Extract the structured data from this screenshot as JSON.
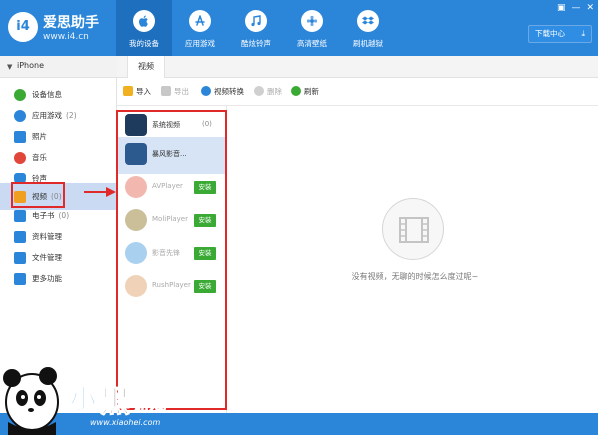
{
  "app": {
    "logo_badge": "i4",
    "name": "爱思助手",
    "url": "www.i4.cn"
  },
  "nav": {
    "tabs": [
      {
        "label": "我的设备",
        "icon": "apple-icon",
        "active": true
      },
      {
        "label": "应用游戏",
        "icon": "app-store-icon",
        "active": false
      },
      {
        "label": "酷炫铃声",
        "icon": "music-note-icon",
        "active": false
      },
      {
        "label": "高清壁纸",
        "icon": "flower-icon",
        "active": false
      },
      {
        "label": "刷机越狱",
        "icon": "dropbox-icon",
        "active": false
      }
    ],
    "download_center": "下载中心",
    "window_controls": [
      "▣",
      "—",
      "✕"
    ]
  },
  "device": {
    "name": "iPhone"
  },
  "sidebar": {
    "items": [
      {
        "label": "设备信息",
        "count": "",
        "icon": "info-icon",
        "color": "#3aaa35"
      },
      {
        "label": "应用游戏",
        "count": "(2)",
        "icon": "apps-icon",
        "color": "#2b86d9"
      },
      {
        "label": "照片",
        "count": "",
        "icon": "photo-icon",
        "color": "#2b86d9"
      },
      {
        "label": "音乐",
        "count": "",
        "icon": "music-icon",
        "color": "#e0463a"
      },
      {
        "label": "铃声",
        "count": "",
        "icon": "bell-icon",
        "color": "#2b86d9"
      },
      {
        "label": "视频",
        "count": "(0)",
        "icon": "video-icon",
        "color": "#f0a020",
        "active": true
      },
      {
        "label": "电子书",
        "count": "(0)",
        "icon": "ebook-icon",
        "color": "#2b86d9"
      },
      {
        "label": "资料管理",
        "count": "",
        "icon": "contacts-icon",
        "color": "#2b86d9"
      },
      {
        "label": "文件管理",
        "count": "",
        "icon": "file-icon",
        "color": "#2b86d9"
      },
      {
        "label": "更多功能",
        "count": "",
        "icon": "more-icon",
        "color": "#2b86d9"
      }
    ]
  },
  "tabs": {
    "current": "视频"
  },
  "toolbar": {
    "import": "导入",
    "export": "导出",
    "convert": "视频转换",
    "delete": "删除",
    "refresh": "刷新"
  },
  "apps": [
    {
      "name": "系统视频",
      "count": "(0)",
      "install": "",
      "icon": "clapperboard-icon",
      "color": "#1e3a5c"
    },
    {
      "name": "暴风影音...",
      "count": "",
      "install": "",
      "icon": "baofeng-icon",
      "color": "#2c5a8e",
      "selected": true
    },
    {
      "name": "AVPlayer",
      "count": "",
      "install": "安装",
      "icon": "avplayer-icon",
      "color": "#f2b8b0",
      "faded": true
    },
    {
      "name": "MoliPlayer",
      "count": "",
      "install": "安装",
      "icon": "moliplayer-icon",
      "color": "#cbbf9a",
      "faded": true
    },
    {
      "name": "影音先锋",
      "count": "",
      "install": "安装",
      "icon": "xfplay-icon",
      "color": "#a9d0ef",
      "faded": true
    },
    {
      "name": "RushPlayer",
      "count": "",
      "install": "安装",
      "icon": "rushplayer-icon",
      "color": "#f0d2b8",
      "faded": true
    }
  ],
  "empty_state": {
    "message": "没有视频，无聊的时候怎么度过呢~"
  },
  "watermark": {
    "text": "小黑游戏",
    "url": "www.xiaohei.com"
  },
  "colors": {
    "primary": "#2b86d9",
    "install_green": "#3aaa35",
    "annotation_red": "#e02a2a"
  }
}
